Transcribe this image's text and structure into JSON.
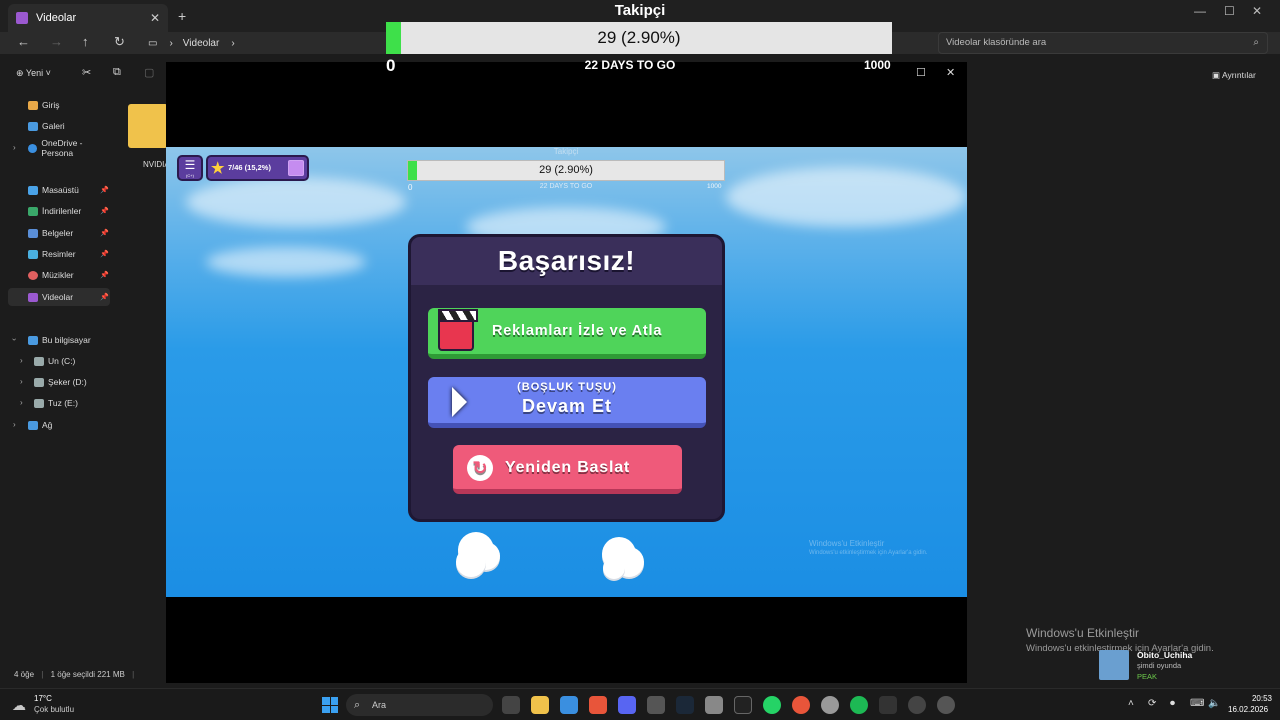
{
  "explorer": {
    "tab_title": "Videolar",
    "breadcrumb": "Videolar",
    "search_placeholder": "Videolar klasöründe ara",
    "new_button": "Yeni",
    "details_button": "Ayrıntılar",
    "sidebar": {
      "top_items": [
        "Giriş",
        "Galeri",
        "OneDrive - Persona"
      ],
      "quick_items": [
        "Masaüstü",
        "İndirilenler",
        "Belgeler",
        "Resimler",
        "Müzikler",
        "Videolar"
      ],
      "pc_label": "Bu bilgisayar",
      "drives": [
        "Un (C:)",
        "Şeker (D:)",
        "Tuz (E:)"
      ],
      "network": "Ağ"
    },
    "folder_label": "NVIDIA",
    "status": {
      "count": "4 öğe",
      "selection": "1 öğe seçildi  221 MB"
    }
  },
  "follower_overlay": {
    "title": "Takipçi",
    "value_text": "29 (2.90%)",
    "progress_fraction": 0.029,
    "min": "0",
    "max": "1000",
    "days_text": "22 DAYS TO GO"
  },
  "game": {
    "hud": {
      "menu_hint": "(C+)",
      "stars": "7/46 (15,2%)"
    },
    "inner_overlay": {
      "title": "Takipçi",
      "value_text": "29 (2.90%)",
      "progress_fraction": 0.029,
      "min": "0",
      "max": "1000",
      "days_text": "22 DAYS TO GO"
    },
    "dialog": {
      "title": "Başarısız!",
      "watch_ads_button": "Reklamları İzle ve Atla",
      "continue_hint": "(BOŞLUK TUŞU)",
      "continue_button": "Devam Et",
      "restart_button": "Yeniden Baslat"
    },
    "activation": {
      "line1": "Windows'u Etkinleştir",
      "line2": "Windows'u etkinleştirmek için Ayarlar'a gidin."
    }
  },
  "desktop_activation": {
    "line1": "Windows'u Etkinleştir",
    "line2": "Windows'u etkinleştirmek için Ayarlar'a gidin."
  },
  "notification": {
    "user": "Obito_Uchiha",
    "status": "şimdi oyunda",
    "game": "PEAK"
  },
  "taskbar": {
    "weather_temp": "17°C",
    "weather_desc": "Çok bulutlu",
    "search_placeholder": "Ara",
    "time": "20:53",
    "date": "16.02.2026"
  },
  "colors": {
    "progress_green": "#3ee04a",
    "dialog_bg": "#2b2344",
    "green_button": "#4fd45a",
    "blue_button": "#6a7ff0",
    "red_button": "#ef5a7a"
  }
}
